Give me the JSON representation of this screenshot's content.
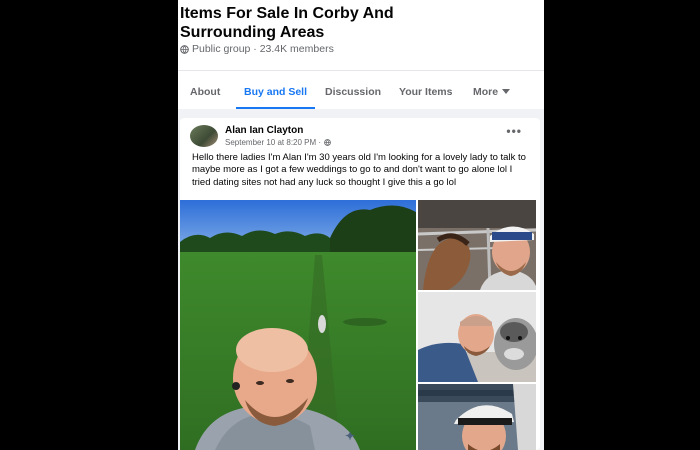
{
  "group": {
    "title": "Items For Sale In Corby And Surrounding Areas",
    "meta": "Public group · 23.4K members",
    "privacy_icon": "globe-icon"
  },
  "tabs": [
    {
      "label": "About",
      "active": false
    },
    {
      "label": "Buy and Sell",
      "active": true
    },
    {
      "label": "Discussion",
      "active": false
    },
    {
      "label": "Your Items",
      "active": false
    },
    {
      "label": "More",
      "active": false,
      "icon": "chevron-down-icon"
    }
  ],
  "post": {
    "author": "Alan Ian Clayton",
    "time": "September 10 at 8:20 PM ·",
    "text": "Hello there ladies I'm Alan I'm 30 years old  I'm looking for a lovely lady to talk to maybe more as I got a few weddings to go to and don't want to go alone lol I tried dating sites not had any luck so thought I give this a go lol",
    "options_icon": "•••",
    "photos": [
      {
        "name": "photo-main",
        "subject": "selfie in park with dog"
      },
      {
        "name": "photo-horse",
        "subject": "selfie with horse"
      },
      {
        "name": "photo-dog",
        "subject": "lying with dog"
      },
      {
        "name": "photo-cap",
        "subject": "selfie in cap"
      }
    ]
  },
  "colors": {
    "accent": "#1877f2",
    "background": "#f0f2f5",
    "frame": "#000000"
  }
}
